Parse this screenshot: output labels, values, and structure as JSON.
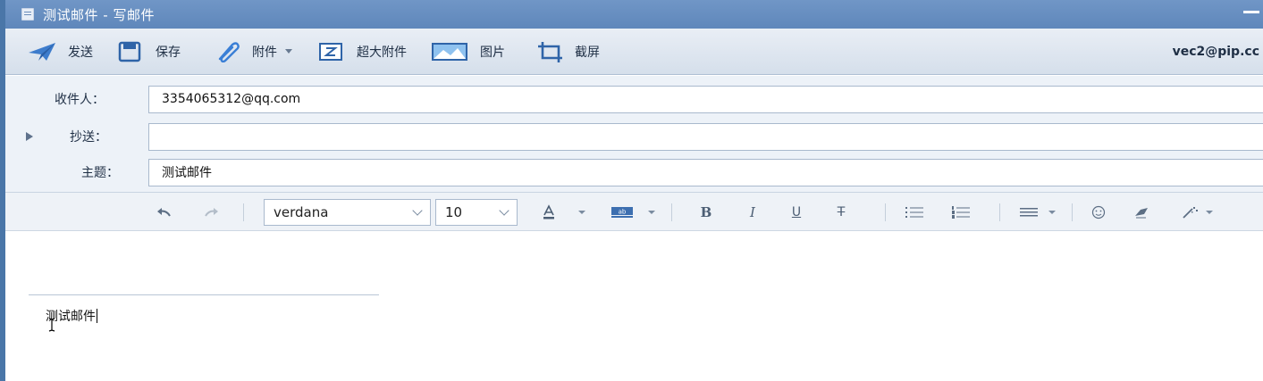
{
  "window": {
    "title": "测试邮件 - 写邮件"
  },
  "toolbar": {
    "send": "发送",
    "save": "保存",
    "attach": "附件",
    "big_attach": "超大附件",
    "image": "图片",
    "screenshot": "截屏",
    "account": "vec2@pip.cc"
  },
  "fields": {
    "to_label": "收件人：",
    "to_value": "3354065312@qq.com",
    "cc_label": "抄送：",
    "cc_value": "",
    "subject_label": "主题：",
    "subject_value": "测试邮件"
  },
  "format": {
    "font": "verdana",
    "size": "10",
    "bold": "B",
    "italic": "I",
    "underline": "U",
    "strike": "T"
  },
  "editor": {
    "body": "测试邮件"
  },
  "colors": {
    "titlebar": "#6790c2",
    "accent": "#3a7fd6"
  }
}
